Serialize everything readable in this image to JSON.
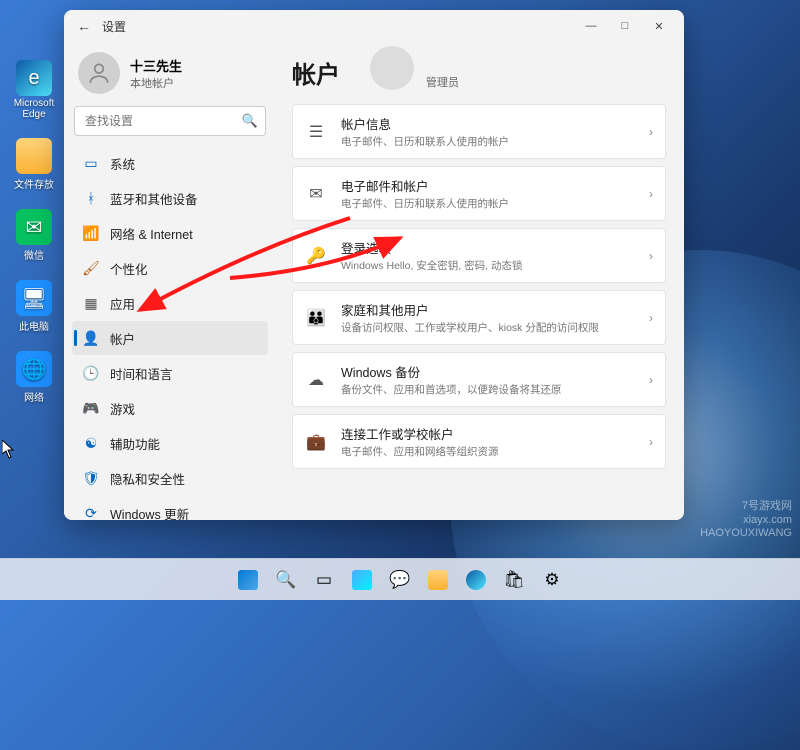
{
  "desktop": {
    "icons": [
      {
        "label": "Microsoft Edge"
      },
      {
        "label": "文件存放"
      },
      {
        "label": "微信"
      },
      {
        "label": "此电脑"
      },
      {
        "label": "网络"
      }
    ]
  },
  "watermark": {
    "line1": "7号游戏网",
    "line2": "xiayx.com",
    "line3": "HAOYOUXIWANG"
  },
  "window": {
    "back": "←",
    "title": "设置",
    "min": "—",
    "max": "□",
    "close": "✕"
  },
  "user": {
    "name": "十三先生",
    "type": "本地帐户"
  },
  "search": {
    "placeholder": "查找设置"
  },
  "nav": {
    "items": [
      {
        "label": "系统"
      },
      {
        "label": "蓝牙和其他设备"
      },
      {
        "label": "网络 & Internet"
      },
      {
        "label": "个性化"
      },
      {
        "label": "应用"
      },
      {
        "label": "帐户"
      },
      {
        "label": "时间和语言"
      },
      {
        "label": "游戏"
      },
      {
        "label": "辅助功能"
      },
      {
        "label": "隐私和安全性"
      },
      {
        "label": "Windows 更新"
      }
    ],
    "active_index": 5
  },
  "page": {
    "title": "帐户",
    "subtitle": "管理员"
  },
  "cards": [
    {
      "title": "帐户信息",
      "subtitle": "电子邮件、日历和联系人使用的帐户"
    },
    {
      "title": "电子邮件和帐户",
      "subtitle": "电子邮件、日历和联系人使用的帐户"
    },
    {
      "title": "登录选项",
      "subtitle": "Windows Hello, 安全密钥, 密码, 动态锁"
    },
    {
      "title": "家庭和其他用户",
      "subtitle": "设备访问权限、工作或学校用户、kiosk 分配的访问权限"
    },
    {
      "title": "Windows 备份",
      "subtitle": "备份文件、应用和首选项，以便跨设备将其还原"
    },
    {
      "title": "连接工作或学校帐户",
      "subtitle": "电子邮件、应用和网络等组织资源"
    }
  ]
}
